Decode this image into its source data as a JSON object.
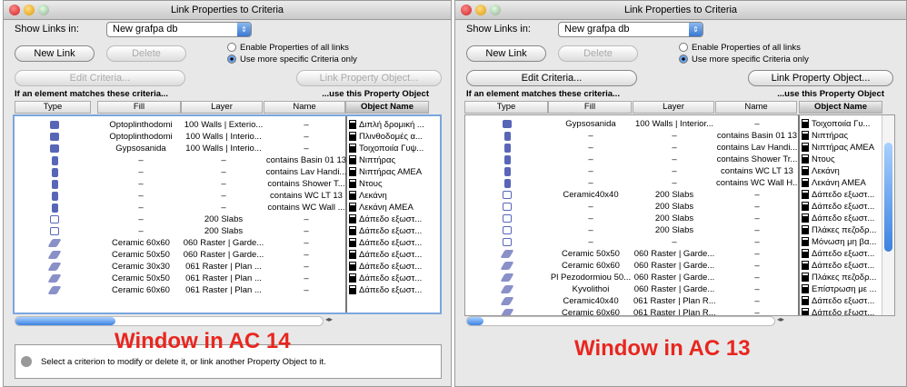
{
  "windows": [
    {
      "id": "w1",
      "title": "Link Properties to Criteria",
      "show_links_label": "Show Links in:",
      "db": "New grafpa db",
      "new_link": "New Link",
      "delete": "Delete",
      "radio1": "Enable Properties of all links",
      "radio2": "Use more specific Criteria only",
      "radio_selected": 2,
      "edit_criteria": "Edit Criteria...",
      "link_property_object": "Link Property Object...",
      "edit_enabled": false,
      "left_header": "If an element matches these criteria...",
      "right_header": "...use this Property Object",
      "columns": [
        "Type",
        "Fill",
        "Layer",
        "Name",
        "Object Name"
      ],
      "rows": [
        [
          "wall",
          "Optoplinthodomi",
          "100 Walls | Exterio...",
          "–",
          "Διπλή δρομική ..."
        ],
        [
          "wall",
          "Optoplinthodomi",
          "100 Walls | Interio...",
          "–",
          "Πλινθοδομές α..."
        ],
        [
          "wall",
          "Gypsosanida",
          "100 Walls | Interio...",
          "–",
          "Τοιχοποιία Γυψ..."
        ],
        [
          "object",
          "–",
          "–",
          "contains Basin 01 13",
          "Νιπτήρας"
        ],
        [
          "object",
          "–",
          "–",
          "contains Lav Handi...",
          "Νιπτήρας ΑΜΕΑ"
        ],
        [
          "object",
          "–",
          "–",
          "contains Shower T...",
          "Ντους"
        ],
        [
          "object",
          "–",
          "–",
          "contains WC LT 13",
          "Λεκάνη"
        ],
        [
          "object",
          "–",
          "–",
          "contains WC Wall ...",
          "Λεκάνη ΑΜΕΑ"
        ],
        [
          "slab",
          "–",
          "200 Slabs",
          "–",
          "Δάπεδο εξωστ..."
        ],
        [
          "slab",
          "–",
          "200 Slabs",
          "–",
          "Δάπεδο εξωστ..."
        ],
        [
          "fill",
          "Ceramic 60x60",
          "060 Raster | Garde...",
          "–",
          "Δάπεδο εξωστ..."
        ],
        [
          "fill",
          "Ceramic 50x50",
          "060 Raster | Garde...",
          "–",
          "Δάπεδο εξωστ..."
        ],
        [
          "fill",
          "Ceramic 30x30",
          "061 Raster | Plan ...",
          "–",
          "Δάπεδο εξωστ..."
        ],
        [
          "fill",
          "Ceramic 50x50",
          "061 Raster | Plan ...",
          "–",
          "Δάπεδο εξωστ..."
        ],
        [
          "fill",
          "Ceramic 60x60",
          "061 Raster | Plan ...",
          "–",
          "Δάπεδο εξωστ..."
        ]
      ],
      "info": "Select a criterion to modify or delete it, or link another Property Object to it.",
      "caption": "Window in AC 14"
    },
    {
      "id": "w2",
      "title": "Link Properties to Criteria",
      "show_links_label": "Show Links in:",
      "db": "New grafpa db",
      "new_link": "New Link",
      "delete": "Delete",
      "radio1": "Enable Properties of all links",
      "radio2": "Use more specific Criteria only",
      "radio_selected": 2,
      "edit_criteria": "Edit Criteria...",
      "link_property_object": "Link Property Object...",
      "edit_enabled": true,
      "left_header": "If an element matches these criteria...",
      "right_header": "...use this Property Object",
      "columns": [
        "Type",
        "Fill",
        "Layer",
        "Name",
        "Object Name"
      ],
      "rows": [
        [
          "wall",
          "Gypsosanida",
          "100 Walls | Interior...",
          "–",
          "Τοιχοποιία Γυ..."
        ],
        [
          "object",
          "–",
          "–",
          "contains Basin 01 13",
          "Νιπτήρας"
        ],
        [
          "object",
          "–",
          "–",
          "contains Lav Handi...",
          "Νιπτήρας ΑΜΕΑ"
        ],
        [
          "object",
          "–",
          "–",
          "contains Shower Tr...",
          "Ντους"
        ],
        [
          "object",
          "–",
          "–",
          "contains WC LT 13",
          "Λεκάνη"
        ],
        [
          "object",
          "–",
          "–",
          "contains WC Wall H...",
          "Λεκάνη ΑΜΕΑ"
        ],
        [
          "slab",
          "Ceramic40x40",
          "200 Slabs",
          "–",
          "Δάπεδο εξωστ..."
        ],
        [
          "slab",
          "–",
          "200 Slabs",
          "–",
          "Δάπεδο εξωστ..."
        ],
        [
          "slab",
          "–",
          "200 Slabs",
          "–",
          "Δάπεδο εξωστ..."
        ],
        [
          "slab",
          "–",
          "200 Slabs",
          "–",
          "Πλάκες πεζοδρ..."
        ],
        [
          "slab",
          "–",
          "–",
          "–",
          "Μόνωση μη βα..."
        ],
        [
          "fill",
          "Ceramic 50x50",
          "060 Raster | Garde...",
          "–",
          "Δάπεδο εξωστ..."
        ],
        [
          "fill",
          "Ceramic 60x60",
          "060 Raster | Garde...",
          "–",
          "Δάπεδο εξωστ..."
        ],
        [
          "fill",
          "Pl Pezodormiou 50...",
          "060 Raster | Garde...",
          "–",
          "Πλάκες πεζοδρ..."
        ],
        [
          "fill",
          "Kyvolithoi",
          "060 Raster | Garde...",
          "–",
          "Επίστρωση με ..."
        ],
        [
          "fill",
          "Ceramic40x40",
          "061 Raster | Plan R...",
          "–",
          "Δάπεδο εξωστ..."
        ],
        [
          "fill",
          "Ceramic 60x60",
          "061 Raster | Plan R...",
          "–",
          "Δάπεδο εξωστ..."
        ]
      ],
      "caption": "Window in AC 13"
    }
  ]
}
